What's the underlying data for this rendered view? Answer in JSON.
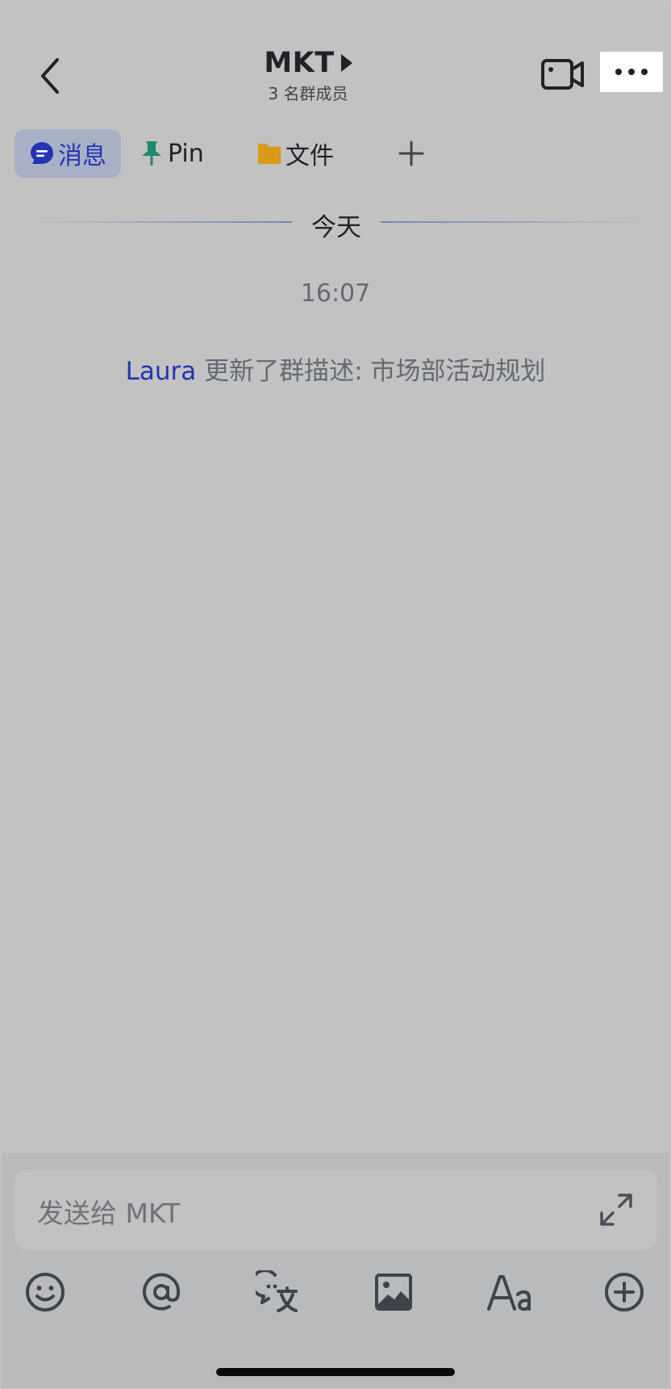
{
  "header": {
    "title": "MKT",
    "subtitle": "3 名群成员"
  },
  "tabs": [
    {
      "label": "消息",
      "icon": "chat-bubble-icon",
      "active": true,
      "color": "#2434b3"
    },
    {
      "label": "Pin",
      "icon": "pin-icon",
      "active": false,
      "color": "#1f8a6e"
    },
    {
      "label": "文件",
      "icon": "folder-icon",
      "active": false,
      "color": "#d89a1a"
    }
  ],
  "chat": {
    "date_divider": "今天",
    "time": "16:07",
    "system_message": {
      "user": "Laura",
      "text": " 更新了群描述: 市场部活动规划"
    }
  },
  "composer": {
    "placeholder": "发送给 MKT",
    "tools": [
      "emoji-icon",
      "mention-icon",
      "translate-icon",
      "image-icon",
      "text-format-icon",
      "add-circle-icon"
    ]
  },
  "colors": {
    "accent": "#2434b3",
    "background": "#c2c2c2",
    "text": "#1f2329",
    "muted": "#646a73"
  }
}
